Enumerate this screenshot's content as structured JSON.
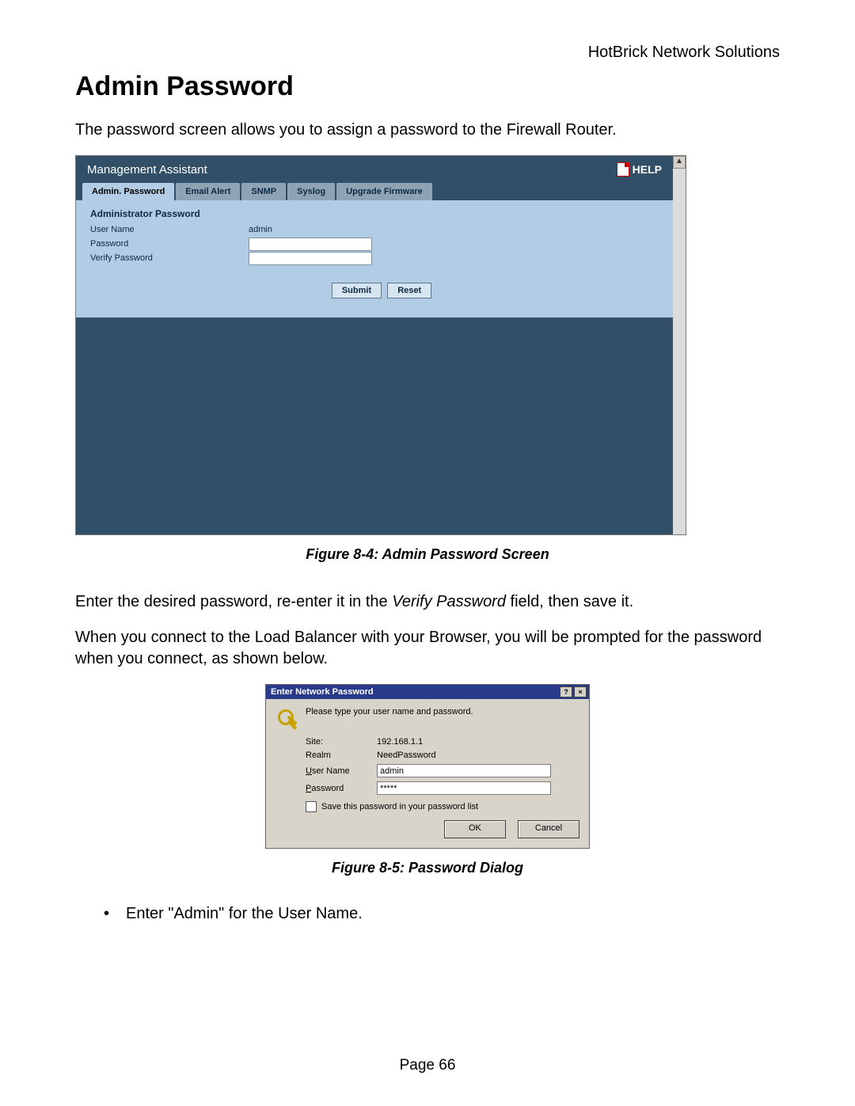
{
  "header_right": "HotBrick Network Solutions",
  "h1": "Admin Password",
  "intro": "The password screen allows you to assign a password to the Firewall Router.",
  "fig1": {
    "title": "Management Assistant",
    "help": "HELP",
    "tabs": [
      "Admin. Password",
      "Email Alert",
      "SNMP",
      "Syslog",
      "Upgrade Firmware"
    ],
    "section": "Administrator Password",
    "rows": {
      "username_label": "User Name",
      "username_value": "admin",
      "password_label": "Password",
      "verify_label": "Verify Password"
    },
    "buttons": {
      "submit": "Submit",
      "reset": "Reset"
    }
  },
  "caption1": "Figure 8-4: Admin Password Screen",
  "para2a": "Enter the desired password, re-enter it in the ",
  "para2b": "Verify Password",
  "para2c": " field, then save it.",
  "para3": "When you connect to the Load Balancer with your Browser, you will be prompted for the password when you connect, as shown below.",
  "fig2": {
    "title": "Enter Network Password",
    "help_btn": "?",
    "close_btn": "×",
    "prompt": "Please type your user name and password.",
    "site_label": "Site:",
    "site_value": "192.168.1.1",
    "realm_label": "Realm",
    "realm_value": "NeedPassword",
    "user_label_pre": "U",
    "user_label": "ser Name",
    "user_value": "admin",
    "pass_label_pre": "P",
    "pass_label": "assword",
    "pass_value": "*****",
    "save_pre": "S",
    "save_label": "ave this password in your password list",
    "ok": "OK",
    "cancel": "Cancel"
  },
  "caption2": "Figure 8-5: Password Dialog",
  "bullet1a": "Enter \"Admin\" for the ",
  "bullet1b": "User Name",
  "bullet1c": ".",
  "page_num": "Page 66"
}
